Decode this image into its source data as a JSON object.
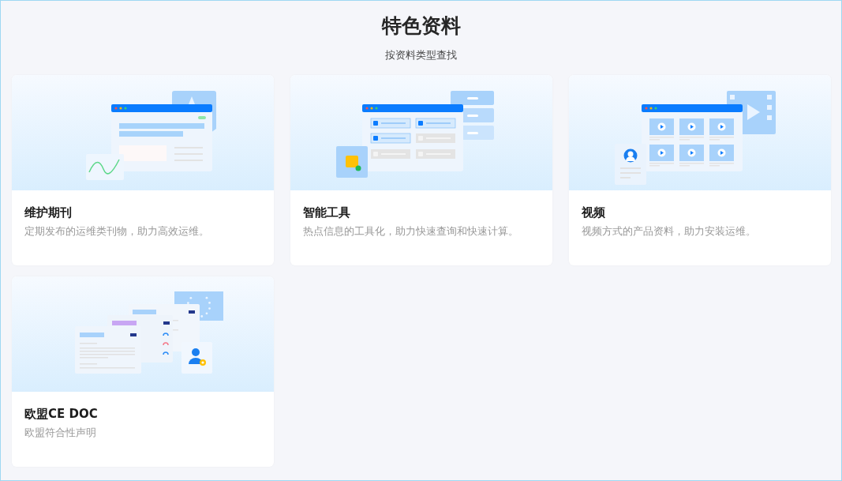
{
  "header": {
    "title": "特色资料",
    "subtitle": "按资料类型查找"
  },
  "cards": [
    {
      "kind": "journal",
      "title": "维护期刊",
      "description": "定期发布的运维类刊物，助力高效运维。"
    },
    {
      "kind": "tools",
      "title": "智能工具",
      "description": "热点信息的工具化，助力快速查询和快速计算。"
    },
    {
      "kind": "video",
      "title": "视频",
      "description": "视频方式的产品资料，助力安装运维。"
    },
    {
      "kind": "ce",
      "title": "欧盟CE DOC",
      "description": "欧盟符合性声明"
    }
  ]
}
